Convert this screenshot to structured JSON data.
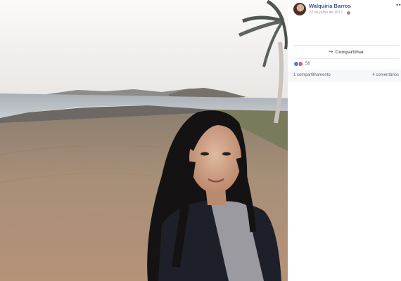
{
  "post": {
    "author": "Walquiria Barros",
    "date": "22 de julho de 2017",
    "separator": "·",
    "more_glyph": "•••",
    "privacy_icon": "globe-icon"
  },
  "actions": {
    "share_label": "Compartilhar",
    "share_icon": "share-arrow-icon"
  },
  "reactions": {
    "icons": [
      "like-icon",
      "love-icon"
    ],
    "count": "56"
  },
  "stats": {
    "shares": "1 compartilhamento",
    "comments": "4 comentários"
  },
  "colors": {
    "author_link": "#365899",
    "like": "#4a7fe8",
    "love": "#f25268",
    "muted_text": "#90949c"
  }
}
